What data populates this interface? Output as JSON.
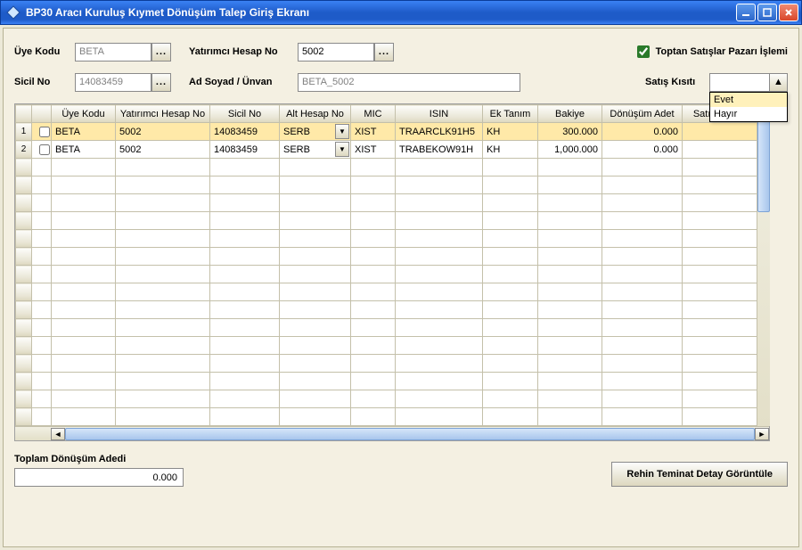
{
  "window": {
    "title": "BP30 Aracı Kuruluş Kıymet Dönüşüm Talep Giriş Ekranı"
  },
  "form": {
    "uye_kodu_label": "Üye Kodu",
    "uye_kodu_value": "BETA",
    "sicil_no_label": "Sicil No",
    "sicil_no_value": "14083459",
    "yatirimci_hesap_label": "Yatırımcı Hesap No",
    "yatirimci_hesap_value": "5002",
    "ad_soyad_label": "Ad Soyad / Ünvan",
    "ad_soyad_value": "BETA_5002",
    "toptan_checkbox_label": "Toptan Satışlar Pazarı İşlemi",
    "toptan_checked": true,
    "satis_kisiti_label": "Satış Kısıtı",
    "satis_kisiti_value": "",
    "satis_kisiti_options": {
      "o1": "Evet",
      "o2": "Hayır"
    }
  },
  "grid": {
    "headers": {
      "uye_kodu": "Üye Kodu",
      "yatirimci_hesap_no": "Yatırımcı Hesap No",
      "sicil_no": "Sicil No",
      "alt_hesap_no": "Alt Hesap No",
      "mic": "MIC",
      "isin": "ISIN",
      "ek_tanim": "Ek Tanım",
      "bakiye": "Bakiye",
      "donusum_adet": "Dönüşüm Adet",
      "satis_suresi": "Satış Süresi"
    },
    "rows": [
      {
        "n": "1",
        "uye_kodu": "BETA",
        "yatirimci_hesap_no": "5002",
        "sicil_no": "14083459",
        "alt_hesap_no": "SERB",
        "mic": "XIST",
        "isin": "TRAARCLK91H5",
        "ek_tanim": "KH",
        "bakiye": "300.000",
        "donusum_adet": "0.000",
        "satis_suresi": ""
      },
      {
        "n": "2",
        "uye_kodu": "BETA",
        "yatirimci_hesap_no": "5002",
        "sicil_no": "14083459",
        "alt_hesap_no": "SERB",
        "mic": "XIST",
        "isin": "TRABEKOW91H",
        "ek_tanim": "KH",
        "bakiye": "1,000.000",
        "donusum_adet": "0.000",
        "satis_suresi": ""
      }
    ]
  },
  "footer": {
    "total_label": "Toplam Dönüşüm Adedi",
    "total_value": "0.000",
    "detail_button": "Rehin Teminat Detay Görüntüle"
  }
}
